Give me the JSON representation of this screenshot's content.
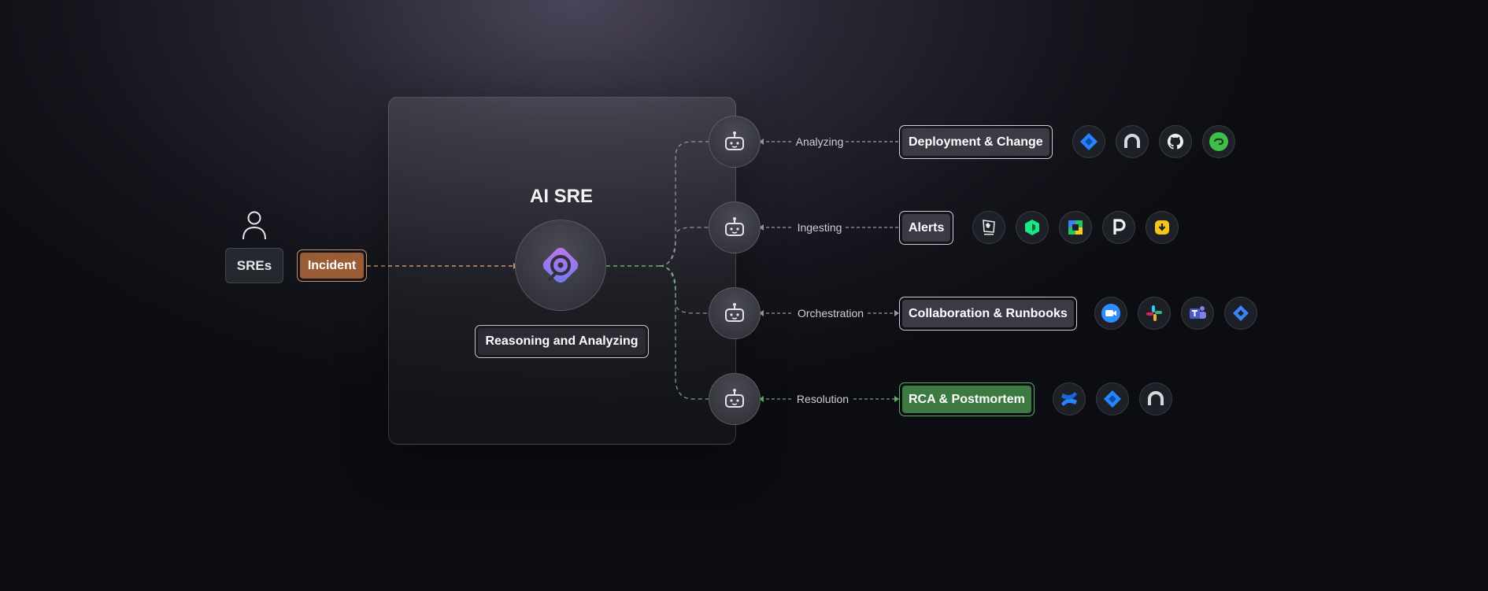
{
  "actor": {
    "label": "SREs",
    "icon": "person-icon"
  },
  "incident": {
    "label": "Incident",
    "color": "#9a5c35"
  },
  "core": {
    "title": "AI SRE",
    "icon": "ai-sre-logo-icon",
    "subtitle": "Reasoning and Analyzing"
  },
  "agents": [
    {
      "icon": "robot-icon",
      "edge_label": "Analyzing",
      "category": "Deployment & Change",
      "tools": [
        "jira-icon",
        "ring-logo-icon",
        "github-icon",
        "link-logo-icon"
      ]
    },
    {
      "icon": "robot-icon",
      "edge_label": "Ingesting",
      "category": "Alerts",
      "tools": [
        "datadog-icon",
        "newrelic-icon",
        "cube-logo-icon",
        "pagerduty-icon",
        "opsgenie-icon"
      ]
    },
    {
      "icon": "robot-icon",
      "edge_label": "Orchestration",
      "category": "Collaboration & Runbooks",
      "tools": [
        "zoom-icon",
        "slack-icon",
        "teams-icon",
        "diamond-logo-icon"
      ]
    },
    {
      "icon": "robot-icon",
      "edge_label": "Resolution",
      "category": "RCA & Postmortem",
      "tools": [
        "confluence-icon",
        "jira-icon",
        "ring-logo-icon"
      ]
    }
  ],
  "colors": {
    "incident_line": "#c98e64",
    "green_line": "#5fae63",
    "gray_line": "#9a9ba3",
    "rca_fill": "#3d7a42"
  }
}
